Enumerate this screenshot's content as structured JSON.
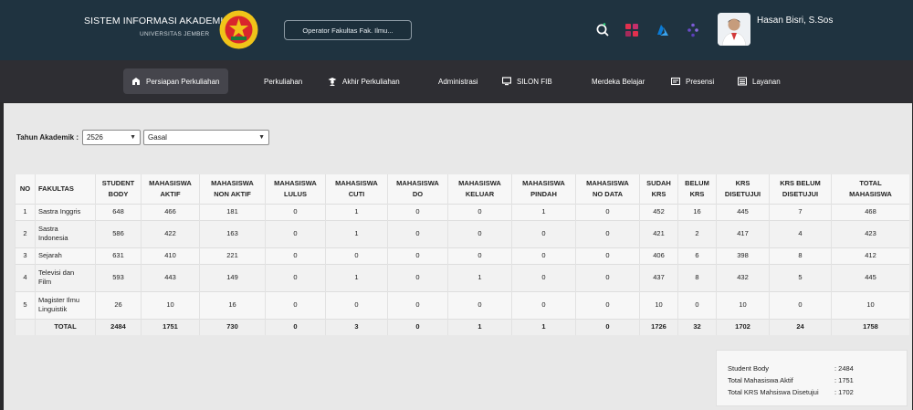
{
  "header": {
    "title": "SISTEM INFORMASI AKADEMIK",
    "subtitle": "UNIVERSITAS JEMBER",
    "operator": "Operator Fakultas Fak. Ilmu...",
    "user_name": "Hasan Bisri, S.Sos",
    "icons": [
      "search-icon",
      "apps-icon",
      "azure-icon",
      "nodes-icon"
    ]
  },
  "nav": [
    {
      "label": "Persiapan Perkuliahan",
      "icon": "building-icon",
      "active": true
    },
    {
      "label": "Perkuliahan",
      "icon": "",
      "active": false
    },
    {
      "label": "Akhir Perkuliahan",
      "icon": "graduate-icon",
      "active": false
    },
    {
      "label": "Administrasi",
      "icon": "",
      "active": false
    },
    {
      "label": "SILON FIB",
      "icon": "monitor-icon",
      "active": false
    },
    {
      "label": "Merdeka Belajar",
      "icon": "",
      "active": false
    },
    {
      "label": "Presensi",
      "icon": "card-icon",
      "active": false
    },
    {
      "label": "Layanan",
      "icon": "list-icon",
      "active": false
    }
  ],
  "filter": {
    "label": "Tahun Akademik :",
    "year": "2526",
    "semester": "Gasal"
  },
  "table": {
    "headers": [
      [
        "NO"
      ],
      [
        "FAKULTAS"
      ],
      [
        "STUDENT",
        "BODY"
      ],
      [
        "MAHASISWA",
        "AKTIF"
      ],
      [
        "MAHASISWA",
        "NON AKTIF"
      ],
      [
        "MAHASISWA",
        "LULUS"
      ],
      [
        "MAHASISWA",
        "CUTI"
      ],
      [
        "MAHASISWA",
        "DO"
      ],
      [
        "MAHASISWA",
        "KELUAR"
      ],
      [
        "MAHASISWA",
        "PINDAH"
      ],
      [
        "MAHASISWA",
        "NO DATA"
      ],
      [
        "SUDAH",
        "KRS"
      ],
      [
        "BELUM",
        "KRS"
      ],
      [
        "KRS",
        "DISETUJUI"
      ],
      [
        "KRS BELUM",
        "DISETUJUI"
      ],
      [
        "TOTAL",
        "MAHASISWA"
      ]
    ],
    "rows": [
      {
        "no": "1",
        "fakultas": [
          "Sastra Inggris"
        ],
        "values": [
          "648",
          "466",
          "181",
          "0",
          "1",
          "0",
          "0",
          "1",
          "0",
          "452",
          "16",
          "445",
          "7",
          "468"
        ]
      },
      {
        "no": "2",
        "fakultas": [
          "Sastra",
          "Indonesia"
        ],
        "values": [
          "586",
          "422",
          "163",
          "0",
          "1",
          "0",
          "0",
          "0",
          "0",
          "421",
          "2",
          "417",
          "4",
          "423"
        ]
      },
      {
        "no": "3",
        "fakultas": [
          "Sejarah"
        ],
        "values": [
          "631",
          "410",
          "221",
          "0",
          "0",
          "0",
          "0",
          "0",
          "0",
          "406",
          "6",
          "398",
          "8",
          "412"
        ]
      },
      {
        "no": "4",
        "fakultas": [
          "Televisi dan",
          "Film"
        ],
        "values": [
          "593",
          "443",
          "149",
          "0",
          "1",
          "0",
          "1",
          "0",
          "0",
          "437",
          "8",
          "432",
          "5",
          "445"
        ]
      },
      {
        "no": "5",
        "fakultas": [
          "Magister Ilmu",
          "Linguistik"
        ],
        "values": [
          "26",
          "10",
          "16",
          "0",
          "0",
          "0",
          "0",
          "0",
          "0",
          "10",
          "0",
          "10",
          "0",
          "10"
        ]
      }
    ],
    "total": {
      "label": "TOTAL",
      "values": [
        "2484",
        "1751",
        "730",
        "0",
        "3",
        "0",
        "1",
        "1",
        "0",
        "1726",
        "32",
        "1702",
        "24",
        "1758"
      ]
    }
  },
  "summary": [
    {
      "label": "Student Body",
      "value": ": 2484"
    },
    {
      "label": "Total Mahasiswa Aktif",
      "value": ": 1751"
    },
    {
      "label": "Total KRS Mahsiswa Disetujui",
      "value": ": 1702"
    }
  ]
}
